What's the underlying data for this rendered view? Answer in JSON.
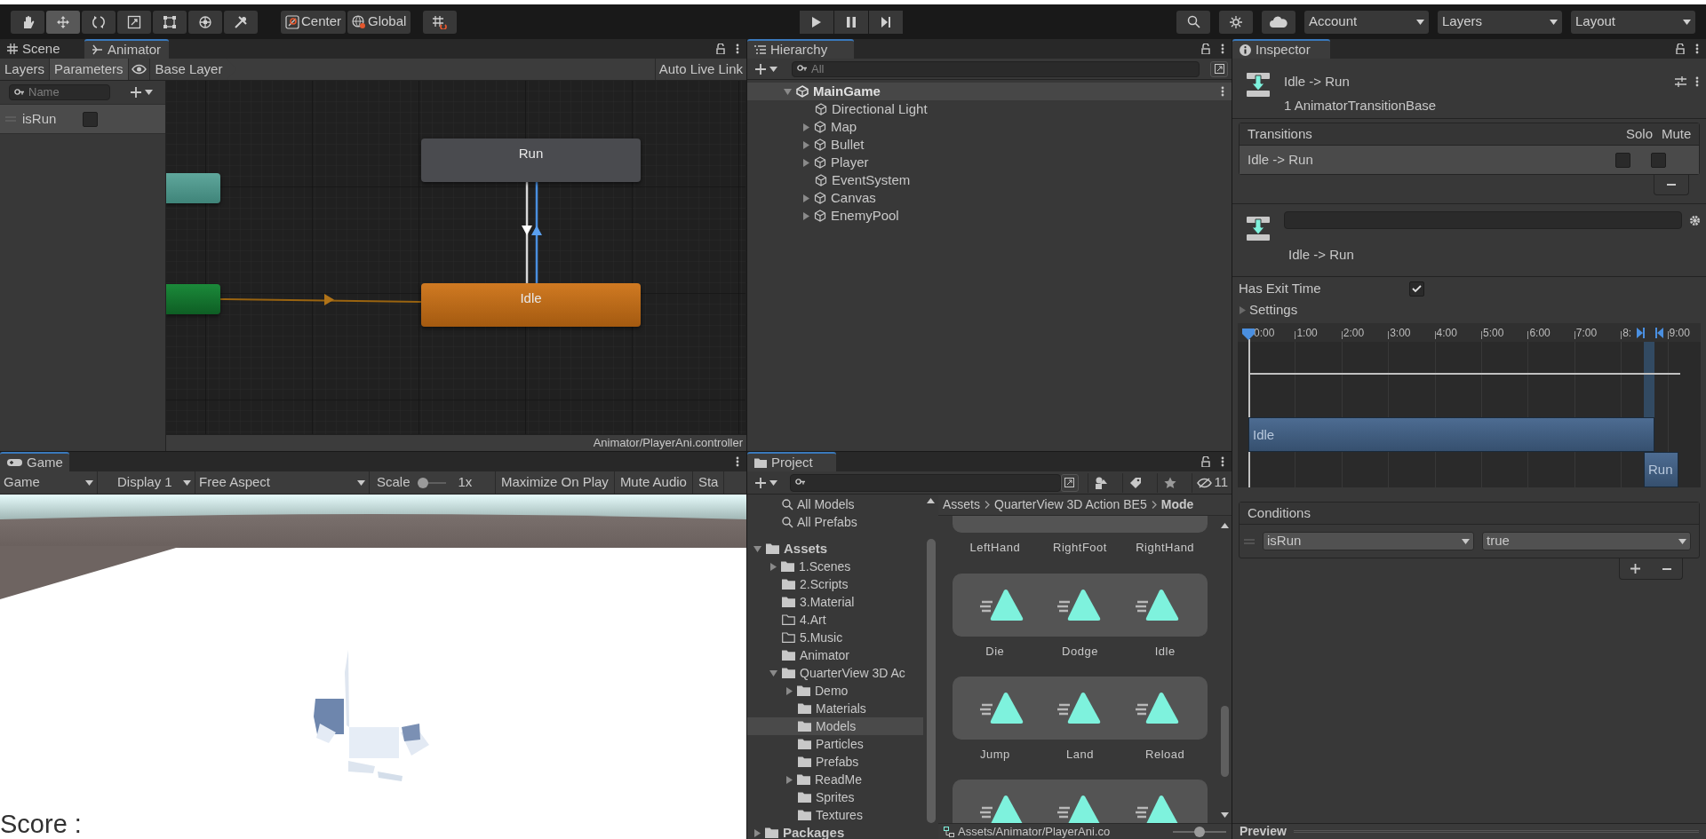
{
  "toolbar": {
    "tools": [
      {
        "kind": "hand",
        "selected": false
      },
      {
        "kind": "move",
        "selected": true
      },
      {
        "kind": "rotate",
        "selected": false
      },
      {
        "kind": "scale",
        "selected": false
      },
      {
        "kind": "rect",
        "selected": false
      },
      {
        "kind": "transform",
        "selected": false
      },
      {
        "kind": "custom",
        "selected": false
      }
    ],
    "pivot_buttons": [
      {
        "kind": "pivot",
        "label": "Center"
      },
      {
        "kind": "global",
        "label": "Global"
      }
    ],
    "play_controls": [
      {
        "kind": "play"
      },
      {
        "kind": "pause"
      },
      {
        "kind": "step"
      }
    ],
    "menus": [
      "Account",
      "Layers",
      "Layout"
    ]
  },
  "animator": {
    "tabs": [
      {
        "label": "Scene",
        "kind": "scene",
        "selected": false
      },
      {
        "label": "Animator",
        "kind": "animator",
        "selected": true
      }
    ],
    "subtabs": [
      {
        "label": "Layers",
        "selected": false
      },
      {
        "label": "Parameters",
        "selected": true
      }
    ],
    "breadcrumb": "Base Layer",
    "live_link": "Auto Live Link",
    "search": {
      "placeholder": "Name"
    },
    "parameters": [
      {
        "name": "isRun",
        "checked": false
      }
    ],
    "states": [
      {
        "kind": "any"
      },
      {
        "kind": "entry"
      },
      {
        "kind": "state",
        "label": "Run"
      },
      {
        "kind": "default",
        "label": "Idle"
      }
    ],
    "footer": "Animator/PlayerAni.controller"
  },
  "game": {
    "tab": "Game",
    "mode": "Game",
    "display": "Display 1",
    "aspect": "Free Aspect",
    "scale_label": "Scale",
    "scale": {
      "level": 0
    },
    "scale_value": "1x",
    "buttons": [
      "Maximize On Play",
      "Mute Audio",
      "Sta"
    ],
    "score": "Score :"
  },
  "hierarchy": {
    "title": "Hierarchy",
    "search": {
      "placeholder": "All"
    },
    "scene": {
      "label": "MainGame",
      "expandable": true,
      "expanded": true,
      "children": [
        {
          "label": "Directional Light",
          "expandable": false
        },
        {
          "label": "Map",
          "expandable": true,
          "expanded": false
        },
        {
          "label": "Bullet",
          "expandable": true,
          "expanded": false
        },
        {
          "label": "Player",
          "expandable": true,
          "expanded": false
        },
        {
          "label": "EventSystem",
          "expandable": false
        },
        {
          "label": "Canvas",
          "expandable": true,
          "expanded": false
        },
        {
          "label": "EnemyPool",
          "expandable": true,
          "expanded": false
        }
      ]
    }
  },
  "project": {
    "title": "Project",
    "hidden_count": "11",
    "favorites": [
      "All Models",
      "All Prefabs"
    ],
    "tree": [
      {
        "label": "Assets",
        "kind": "folder",
        "expandable": true,
        "expanded": true,
        "selected": false,
        "children": [
          {
            "label": "1.Scenes",
            "kind": "folder",
            "expandable": true,
            "expanded": false,
            "selected": false
          },
          {
            "label": "2.Scripts",
            "kind": "folder",
            "expandable": false,
            "selected": false
          },
          {
            "label": "3.Material",
            "kind": "folder",
            "expandable": false,
            "selected": false
          },
          {
            "label": "4.Art",
            "kind": "empty_folder",
            "expandable": false,
            "selected": false
          },
          {
            "label": "5.Music",
            "kind": "empty_folder",
            "expandable": false,
            "selected": false
          },
          {
            "label": "Animator",
            "kind": "folder",
            "expandable": false,
            "selected": false
          },
          {
            "label": "QuarterView 3D Ac",
            "kind": "folder",
            "expandable": true,
            "expanded": true,
            "selected": false,
            "children": [
              {
                "label": "Demo",
                "kind": "folder",
                "expandable": true,
                "expanded": false,
                "selected": false
              },
              {
                "label": "Materials",
                "kind": "folder",
                "expandable": false,
                "selected": false
              },
              {
                "label": "Models",
                "kind": "folder",
                "expandable": false,
                "selected": true
              },
              {
                "label": "Particles",
                "kind": "folder",
                "expandable": false,
                "selected": false
              },
              {
                "label": "Prefabs",
                "kind": "folder",
                "expandable": false,
                "selected": false
              },
              {
                "label": "ReadMe",
                "kind": "folder",
                "expandable": true,
                "expanded": false,
                "selected": false
              },
              {
                "label": "Sprites",
                "kind": "folder",
                "expandable": false,
                "selected": false
              },
              {
                "label": "Textures",
                "kind": "folder",
                "expandable": false,
                "selected": false
              }
            ]
          }
        ]
      },
      {
        "label": "Packages",
        "kind": "folder",
        "expandable": true,
        "expanded": false,
        "selected": false
      }
    ],
    "breadcrumb": [
      "Assets",
      "QuarterView 3D Action BE5",
      "Mode"
    ],
    "asset_rows": [
      {
        "kind": "cut_top",
        "items": [
          "LeftHand",
          "RightFoot",
          "RightHand"
        ]
      },
      {
        "kind": "clips",
        "items": [
          "Die",
          "Dodge",
          "Idle"
        ]
      },
      {
        "kind": "clips",
        "items": [
          "Jump",
          "Land",
          "Reload"
        ]
      },
      {
        "kind": "cut_bottom"
      }
    ],
    "footer_path": "Assets/Animator/PlayerAni.co",
    "icon_size": {
      "level": 0.5
    }
  },
  "inspector": {
    "title": "Inspector",
    "header_title": "Idle -> Run",
    "header_subtitle": "1 AnimatorTransitionBase",
    "transitions": {
      "title": "Transitions",
      "columns": [
        "Solo",
        "Mute"
      ],
      "rows": [
        {
          "name": "Idle -> Run",
          "solo": false,
          "mute": false
        }
      ]
    },
    "sub_label": "Idle -> Run",
    "has_exit_time": {
      "label": "Has Exit Time",
      "checked": true
    },
    "settings": {
      "label": "Settings",
      "expanded": false
    },
    "timeline": {
      "ticks": [
        "0:00",
        "1:00",
        "2:00",
        "3:00",
        "4:00",
        "5:00",
        "6:00",
        "7:00",
        "8:",
        "9:00"
      ],
      "clips": [
        "Idle",
        "Run"
      ]
    },
    "conditions": {
      "title": "Conditions",
      "rows": [
        {
          "parameter": "isRun",
          "value": "true"
        }
      ]
    },
    "preview": "Preview"
  }
}
